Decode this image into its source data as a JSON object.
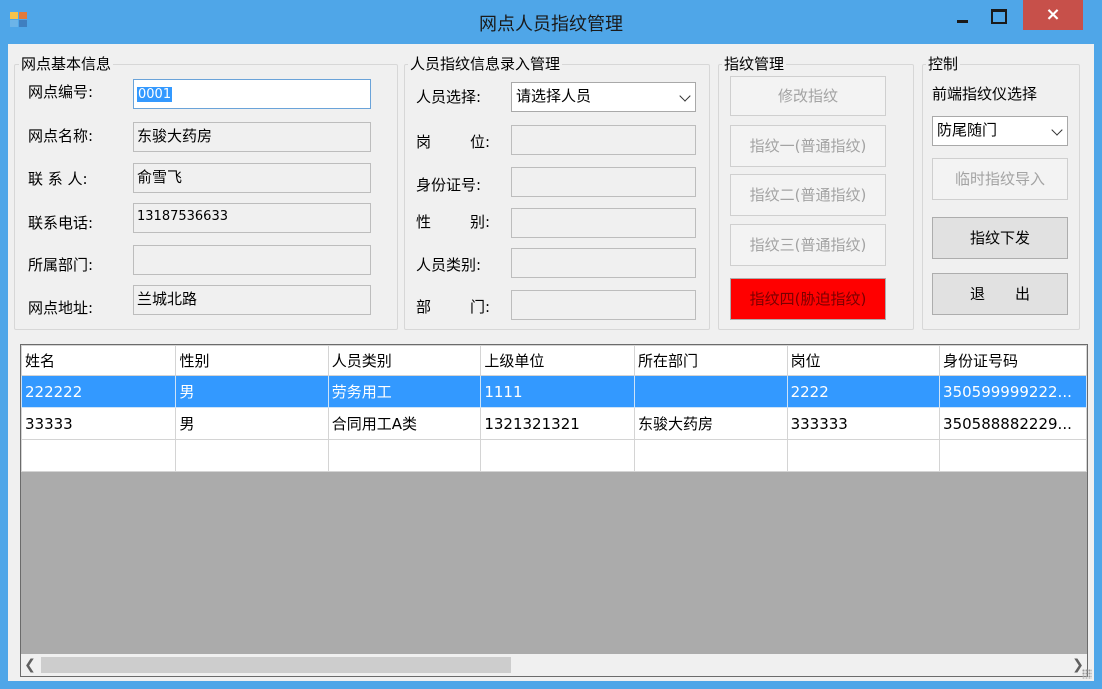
{
  "window": {
    "title": "网点人员指纹管理",
    "close_label": "×"
  },
  "basic_info": {
    "group_title": "网点基本信息",
    "code_label": "网点编号:",
    "code_value": "0001",
    "name_label": "网点名称:",
    "name_value": "东骏大药房",
    "contact_label": "联 系 人:",
    "contact_value": "俞雪飞",
    "phone_label": "联系电话:",
    "phone_value": "13187536633",
    "dept_label": "所属部门:",
    "dept_value": "",
    "address_label": "网点地址:",
    "address_value": "兰城北路"
  },
  "person_info": {
    "group_title": "人员指纹信息录入管理",
    "select_label": "人员选择:",
    "select_value": "请选择人员",
    "post_label": "岗　　位:",
    "post_label_a": "岗",
    "post_label_b": "位:",
    "id_label": "身份证号:",
    "gender_label_a": "性",
    "gender_label_b": "别:",
    "type_label": "人员类别:",
    "dept_label_a": "部",
    "dept_label_b": "门:"
  },
  "fingerprint": {
    "group_title": "指纹管理",
    "modify_label": "修改指纹",
    "fp1_label": "指纹一(普通指纹)",
    "fp2_label": "指纹二(普通指纹)",
    "fp3_label": "指纹三(普通指纹)",
    "fp4_label": "指纹四(胁迫指纹)"
  },
  "control": {
    "group_title": "控制",
    "device_label": "前端指纹仪选择",
    "device_value": "防尾随门",
    "import_label": "临时指纹导入",
    "send_label": "指纹下发",
    "exit_label": "退　　出"
  },
  "table": {
    "columns": [
      "姓名",
      "性别",
      "人员类别",
      "上级单位",
      "所在部门",
      "岗位",
      "身份证号码"
    ],
    "rows": [
      [
        "222222",
        "男",
        "劳务用工",
        "1111",
        "",
        "2222",
        "350599999222..."
      ],
      [
        "33333",
        "男",
        "合同用工A类",
        "1321321321",
        "东骏大药房",
        "333333",
        "350588882229..."
      ],
      [
        "",
        "",
        "",
        "",
        "",
        "",
        ""
      ]
    ]
  },
  "colors": {
    "titlebar": "#4fa6e8",
    "close_button": "#c7504a",
    "selection": "#3399ff",
    "danger_button": "#ff0000"
  }
}
